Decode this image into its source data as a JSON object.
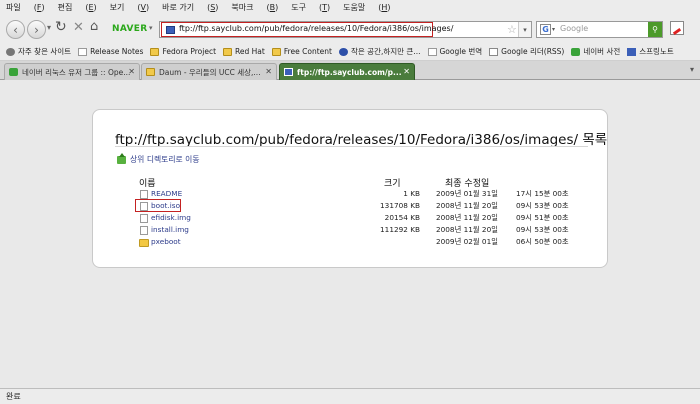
{
  "menubar": {
    "items": [
      {
        "label": "파일",
        "key": "F"
      },
      {
        "label": "편집",
        "key": "E"
      },
      {
        "label": "보기",
        "key": "V"
      },
      {
        "label": "바로 가기",
        "key": "S"
      },
      {
        "label": "북마크",
        "key": "B"
      },
      {
        "label": "도구",
        "key": "T"
      },
      {
        "label": "도움말",
        "key": "H"
      }
    ]
  },
  "navbar": {
    "brand": "NAVER",
    "url": "ftp://ftp.sayclub.com/pub/fedora/releases/10/Fedora/i386/os/images/",
    "search_placeholder": "Google",
    "search_engine_icon": "google-icon"
  },
  "bookmarks": [
    {
      "label": "자주 찾은 사이트",
      "icon": "gear-icon"
    },
    {
      "label": "Release Notes",
      "icon": "doc-icon"
    },
    {
      "label": "Fedora Project",
      "icon": "folder-icon"
    },
    {
      "label": "Red Hat",
      "icon": "folder-icon"
    },
    {
      "label": "Free Content",
      "icon": "folder-icon"
    },
    {
      "label": "작은 공간,하지만 큰...",
      "icon": "m-icon"
    },
    {
      "label": "Google 번역",
      "icon": "doc-icon"
    },
    {
      "label": "Google 리더(RSS)",
      "icon": "google-icon"
    },
    {
      "label": "네이버 사전",
      "icon": "green-icon"
    },
    {
      "label": "스프링노트",
      "icon": "blue-icon"
    }
  ],
  "tabs": [
    {
      "label": "네이버 리눅스 유저 그룹 :: Ope...",
      "active": false
    },
    {
      "label": "Daum - 우리들의 UCC 세상,...",
      "active": false
    },
    {
      "label": "ftp://ftp.sayclub.com/p...",
      "active": true
    }
  ],
  "listing": {
    "title": "ftp://ftp.sayclub.com/pub/fedora/releases/10/Fedora/i386/os/images/ 목록",
    "up_link": "상위 디렉토리로 이동",
    "headers": {
      "name": "이름",
      "size": "크기",
      "modified": "최종 수정일"
    },
    "files": [
      {
        "name": "README",
        "size": "1 KB",
        "date": "2009년 01월 31일",
        "time": "17시 15분 00초",
        "type": "file",
        "highlighted": false
      },
      {
        "name": "boot.iso",
        "size": "131708 KB",
        "date": "2008년 11월 20일",
        "time": "09시 53분 00초",
        "type": "file",
        "highlighted": true
      },
      {
        "name": "efidisk.img",
        "size": "20154 KB",
        "date": "2008년 11월 20일",
        "time": "09시 51분 00초",
        "type": "file",
        "highlighted": false
      },
      {
        "name": "install.img",
        "size": "111292 KB",
        "date": "2008년 11월 20일",
        "time": "09시 53분 00초",
        "type": "file",
        "highlighted": false
      },
      {
        "name": "pxeboot",
        "size": "",
        "date": "2009년 02월 01일",
        "time": "06시 50분 00초",
        "type": "folder",
        "highlighted": false
      }
    ]
  },
  "status": {
    "text": "완료"
  }
}
